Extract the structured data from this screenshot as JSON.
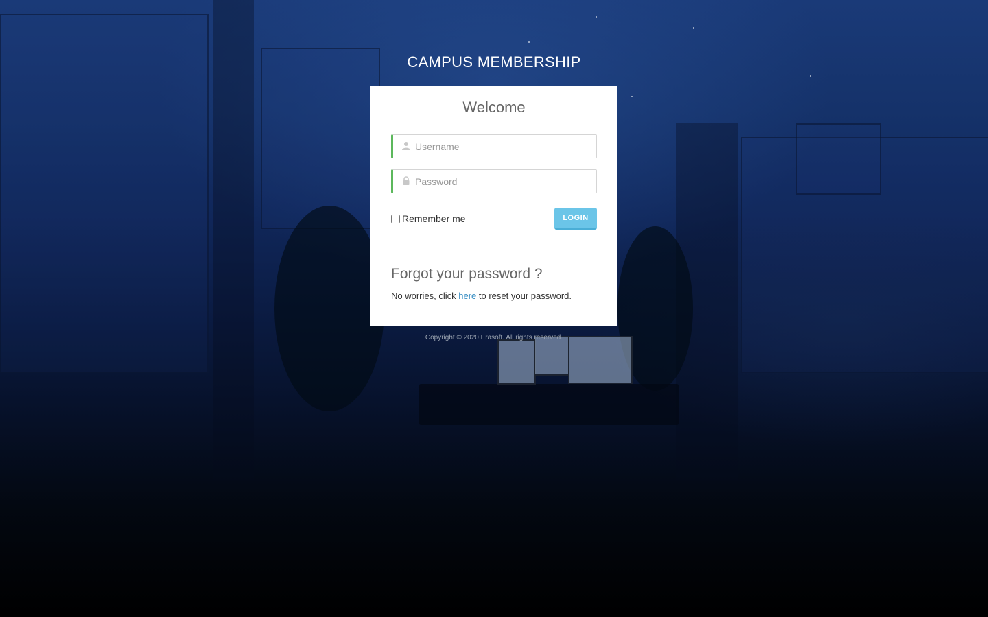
{
  "app": {
    "title": "CAMPUS MEMBERSHIP"
  },
  "login_card": {
    "heading": "Welcome",
    "username": {
      "placeholder": "Username",
      "value": "",
      "icon": "user-icon"
    },
    "password": {
      "placeholder": "Password",
      "value": "",
      "icon": "lock-icon"
    },
    "remember_label": "Remember me",
    "remember_checked": false,
    "login_label": "LOGIN"
  },
  "forgot": {
    "title": "Forgot your password ?",
    "text_before": "No worries, click ",
    "link_text": "here",
    "text_after": " to reset your password."
  },
  "footer": {
    "copyright": "Copyright © 2020 Erasoft. All rights reserved."
  },
  "colors": {
    "accent_green": "#5cb85c",
    "login_button": "#6bc5e8",
    "link": "#3a8fc4"
  }
}
